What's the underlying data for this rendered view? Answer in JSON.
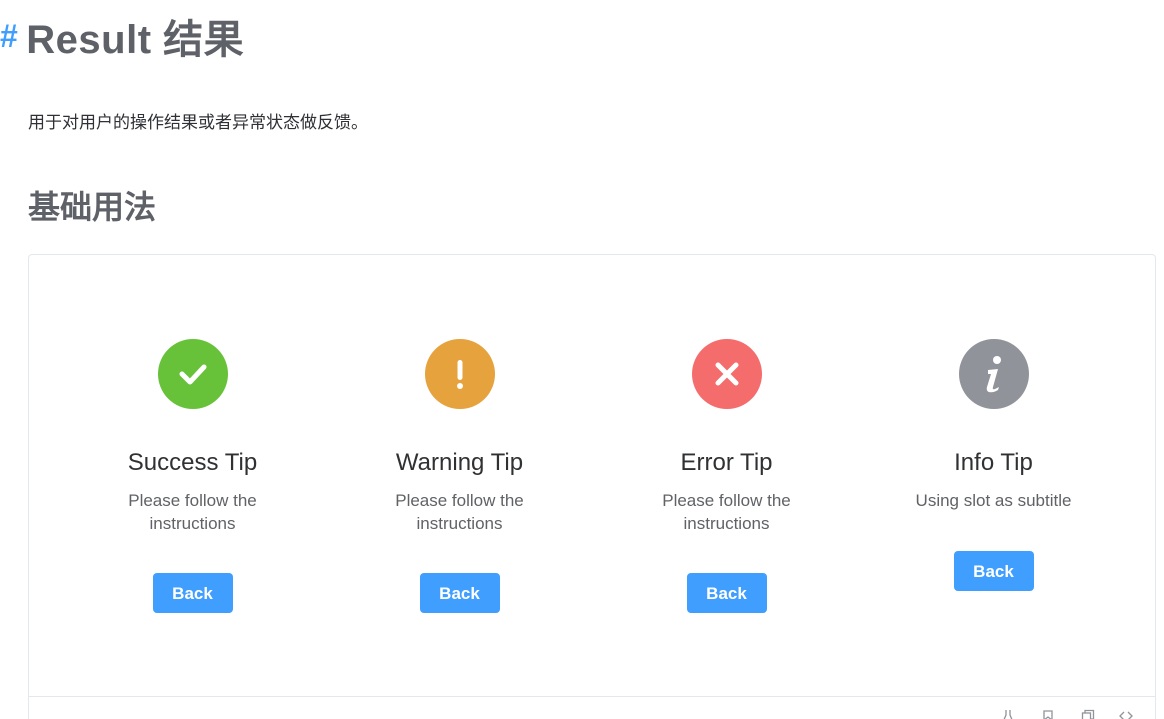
{
  "header": {
    "anchor": "#",
    "title": "Result 结果"
  },
  "intro": "用于对用户的操作结果或者异常状态做反馈。",
  "section_title": "基础用法",
  "results": [
    {
      "icon": "check-icon",
      "color": "#67c23a",
      "title": "Success Tip",
      "subtitle": "Please follow the instructions",
      "button": "Back"
    },
    {
      "icon": "exclamation-icon",
      "color": "#e6a23c",
      "title": "Warning Tip",
      "subtitle": "Please follow the instructions",
      "button": "Back"
    },
    {
      "icon": "close-icon",
      "color": "#f56c6c",
      "title": "Error Tip",
      "subtitle": "Please follow the instructions",
      "button": "Back"
    },
    {
      "icon": "info-icon",
      "color": "#909399",
      "title": "Info Tip",
      "subtitle": "Using slot as subtitle",
      "button": "Back"
    }
  ],
  "footer_tools": [
    "playground-icon",
    "github-icon",
    "copy-icon",
    "code-icon"
  ]
}
